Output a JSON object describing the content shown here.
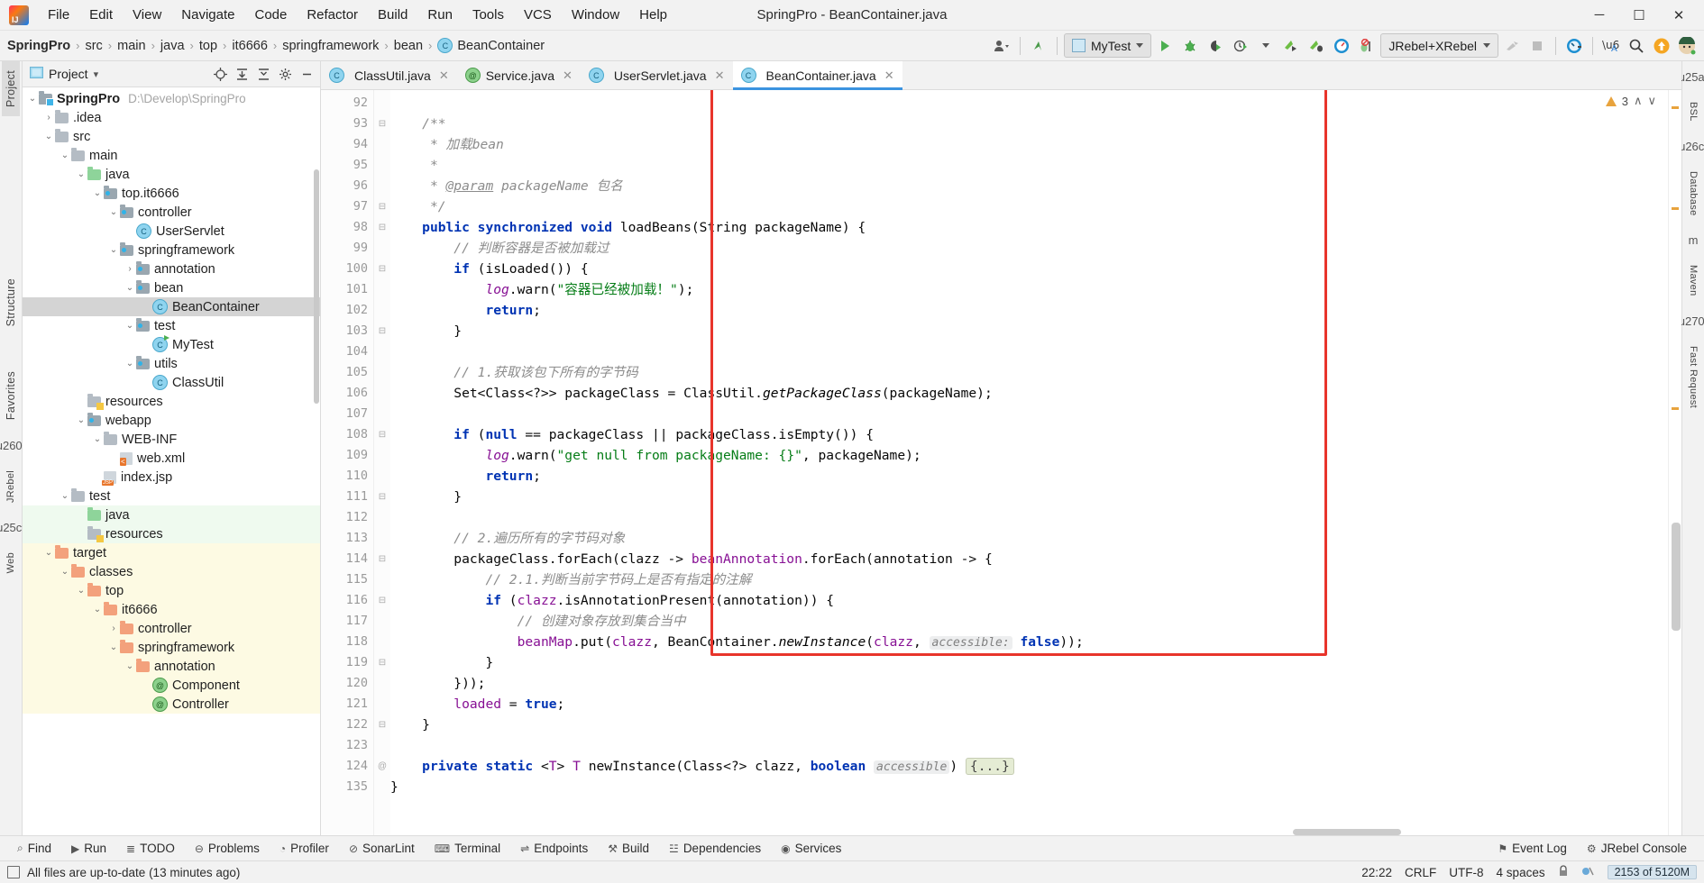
{
  "window": {
    "title": "SpringPro - BeanContainer.java",
    "minimize": "─",
    "maximize": "☐",
    "close": "✕"
  },
  "menubar": {
    "logo": "intellij-idea-logo",
    "items": [
      "File",
      "Edit",
      "View",
      "Navigate",
      "Code",
      "Refactor",
      "Build",
      "Run",
      "Tools",
      "VCS",
      "Window",
      "Help"
    ]
  },
  "breadcrumb": {
    "sep": "›",
    "items": [
      {
        "label": "SpringPro",
        "bold": true
      },
      {
        "label": "src",
        "bold": false
      },
      {
        "label": "main",
        "bold": false
      },
      {
        "label": "java",
        "bold": false
      },
      {
        "label": "top",
        "bold": false
      },
      {
        "label": "it6666",
        "bold": false
      },
      {
        "label": "springframework",
        "bold": false
      },
      {
        "label": "bean",
        "bold": false
      },
      {
        "label": "BeanContainer",
        "bold": false,
        "icon": "class-icon",
        "icon_char": "C"
      }
    ]
  },
  "toolbar": {
    "vcs_user_icon": "user-dropdown-icon",
    "update_icon": "update-project-icon",
    "run_config": {
      "label": "MyTest",
      "icon": "run-configuration-icon",
      "caret": "⌄"
    },
    "run_icon": "run-icon",
    "debug_icon": "debug-icon",
    "run_coverage_icon": "run-with-coverage-icon",
    "profiler_icon": "profiler-icon",
    "jrebel_run_icon": "jrebel-run-icon",
    "jrebel_debug_icon": "jrebel-debug-icon",
    "xrebel_icon": "xrebel-icon",
    "stop_jrebel_icon": "jrebel-stop-icon",
    "jrebel_combo": {
      "label": "JRebel+XRebel",
      "caret": "⌄"
    },
    "hammer_icon": "build-icon",
    "stop_icon": "stop-icon",
    "gauge_icon": "jrebel-gauge-icon",
    "translate_icon": "translate-icon",
    "search_icon": "search-everywhere-icon",
    "upload_icon": "upload-icon",
    "avatar_icon": "user-avatar-icon"
  },
  "left_rail": {
    "tabs": [
      "Project",
      "Structure",
      "Favorites"
    ],
    "icons": [
      "jrebel-rail-icon",
      "web-rail-icon"
    ]
  },
  "right_rail": {
    "tabs": [
      "BSL",
      "Database",
      "Maven",
      "Fast Request"
    ]
  },
  "project_panel": {
    "title": "Project",
    "title_caret": "▾",
    "icons": [
      "locate-icon",
      "expand-all-icon",
      "collapse-all-icon",
      "settings-icon",
      "hide-icon"
    ],
    "tree": [
      {
        "depth": 0,
        "arrow": "down",
        "icon": "module-folder",
        "label": "SpringPro",
        "bold": true,
        "path": "D:\\Develop\\SpringPro",
        "hl": ""
      },
      {
        "depth": 1,
        "arrow": "right",
        "icon": "folder",
        "label": ".idea",
        "hl": ""
      },
      {
        "depth": 1,
        "arrow": "down",
        "icon": "folder",
        "label": "src",
        "hl": ""
      },
      {
        "depth": 2,
        "arrow": "down",
        "icon": "folder",
        "label": "main",
        "hl": ""
      },
      {
        "depth": 3,
        "arrow": "down",
        "icon": "source-folder",
        "label": "java",
        "hl": ""
      },
      {
        "depth": 4,
        "arrow": "down",
        "icon": "package",
        "label": "top.it6666",
        "hl": ""
      },
      {
        "depth": 5,
        "arrow": "down",
        "icon": "package",
        "label": "controller",
        "hl": ""
      },
      {
        "depth": 6,
        "arrow": "none",
        "icon": "class",
        "label": "UserServlet",
        "hl": ""
      },
      {
        "depth": 5,
        "arrow": "down",
        "icon": "package",
        "label": "springframework",
        "hl": ""
      },
      {
        "depth": 6,
        "arrow": "right",
        "icon": "package",
        "label": "annotation",
        "hl": ""
      },
      {
        "depth": 6,
        "arrow": "down",
        "icon": "package",
        "label": "bean",
        "hl": ""
      },
      {
        "depth": 7,
        "arrow": "none",
        "icon": "class",
        "label": "BeanContainer",
        "hl": "selected"
      },
      {
        "depth": 6,
        "arrow": "down",
        "icon": "package",
        "label": "test",
        "hl": ""
      },
      {
        "depth": 7,
        "arrow": "none",
        "icon": "class-runnable",
        "label": "MyTest",
        "hl": ""
      },
      {
        "depth": 6,
        "arrow": "down",
        "icon": "package",
        "label": "utils",
        "hl": ""
      },
      {
        "depth": 7,
        "arrow": "none",
        "icon": "class",
        "label": "ClassUtil",
        "hl": ""
      },
      {
        "depth": 3,
        "arrow": "none",
        "icon": "resources-folder",
        "label": "resources",
        "hl": ""
      },
      {
        "depth": 3,
        "arrow": "down",
        "icon": "webapp-folder",
        "label": "webapp",
        "hl": ""
      },
      {
        "depth": 4,
        "arrow": "down",
        "icon": "folder",
        "label": "WEB-INF",
        "hl": ""
      },
      {
        "depth": 5,
        "arrow": "none",
        "icon": "xml-file",
        "label": "web.xml",
        "hl": ""
      },
      {
        "depth": 4,
        "arrow": "none",
        "icon": "jsp-file",
        "label": "index.jsp",
        "hl": ""
      },
      {
        "depth": 2,
        "arrow": "down",
        "icon": "folder",
        "label": "test",
        "hl": ""
      },
      {
        "depth": 3,
        "arrow": "none",
        "icon": "test-source-folder",
        "label": "java",
        "hl": "green"
      },
      {
        "depth": 3,
        "arrow": "none",
        "icon": "test-resources-folder",
        "label": "resources",
        "hl": "green"
      },
      {
        "depth": 1,
        "arrow": "down",
        "icon": "excluded-folder",
        "label": "target",
        "hl": "yellow"
      },
      {
        "depth": 2,
        "arrow": "down",
        "icon": "excluded-folder",
        "label": "classes",
        "hl": "yellow"
      },
      {
        "depth": 3,
        "arrow": "down",
        "icon": "excluded-folder",
        "label": "top",
        "hl": "yellow"
      },
      {
        "depth": 4,
        "arrow": "down",
        "icon": "excluded-folder",
        "label": "it6666",
        "hl": "yellow"
      },
      {
        "depth": 5,
        "arrow": "right",
        "icon": "excluded-folder",
        "label": "controller",
        "hl": "yellow"
      },
      {
        "depth": 5,
        "arrow": "down",
        "icon": "excluded-folder",
        "label": "springframework",
        "hl": "yellow"
      },
      {
        "depth": 6,
        "arrow": "down",
        "icon": "excluded-folder",
        "label": "annotation",
        "hl": "yellow"
      },
      {
        "depth": 7,
        "arrow": "none",
        "icon": "annotation-class",
        "label": "Component",
        "hl": "yellow"
      },
      {
        "depth": 7,
        "arrow": "none",
        "icon": "annotation-class",
        "label": "Controller",
        "hl": "yellow"
      }
    ]
  },
  "editor": {
    "tabs": [
      {
        "label": "ClassUtil.java",
        "icon": "class-icon",
        "icon_char": "C",
        "active": false,
        "close": "✕"
      },
      {
        "label": "Service.java",
        "icon": "annotation-icon",
        "icon_char": "@",
        "active": false,
        "close": "✕"
      },
      {
        "label": "UserServlet.java",
        "icon": "class-icon",
        "icon_char": "C",
        "active": false,
        "close": "✕"
      },
      {
        "label": "BeanContainer.java",
        "icon": "class-icon",
        "icon_char": "C",
        "active": true,
        "close": "✕"
      }
    ],
    "inspection": {
      "count": "3",
      "up": "∧",
      "down": "∨",
      "icon": "warning-triangle-icon"
    },
    "first_line": 92,
    "lines": [
      {
        "n": 92,
        "fold": "",
        "html": ""
      },
      {
        "n": 93,
        "fold": "minus",
        "html": "    <span class='doc'>/**</span>"
      },
      {
        "n": 94,
        "fold": "",
        "html": "     <span class='doc'>* 加载bean</span>"
      },
      {
        "n": 95,
        "fold": "",
        "html": "     <span class='doc'>*</span>"
      },
      {
        "n": 96,
        "fold": "",
        "html": "     <span class='doc'>* </span><span class='docp'>@param</span><span class='doc'> packageName 包名</span>"
      },
      {
        "n": 97,
        "fold": "minus",
        "html": "     <span class='doc'>*/</span>"
      },
      {
        "n": 98,
        "fold": "minus",
        "html": "    <span class='k'>public synchronized void</span> loadBeans(String packageName) {"
      },
      {
        "n": 99,
        "fold": "",
        "html": "        <span class='c'>// 判断容器是否被加载过</span>"
      },
      {
        "n": 100,
        "fold": "minus",
        "html": "        <span class='k'>if</span> (isLoaded()) {"
      },
      {
        "n": 101,
        "fold": "",
        "html": "            <span class='f'><i>log</i></span>.warn(<span class='s'>\"容器已经被加载！\"</span>);"
      },
      {
        "n": 102,
        "fold": "",
        "html": "            <span class='k'>return</span>;"
      },
      {
        "n": 103,
        "fold": "minus",
        "html": "        }"
      },
      {
        "n": 104,
        "fold": "",
        "html": ""
      },
      {
        "n": 105,
        "fold": "",
        "html": "        <span class='c'>// 1.获取该包下所有的字节码</span>"
      },
      {
        "n": 106,
        "fold": "",
        "html": "        Set&lt;Class&lt;?&gt;&gt; packageClass = ClassUtil.<span class='m'>getPackageClass</span>(packageName);"
      },
      {
        "n": 107,
        "fold": "",
        "html": ""
      },
      {
        "n": 108,
        "fold": "minus",
        "html": "        <span class='k'>if</span> (<span class='k'>null</span> == packageClass || packageClass.isEmpty()) {"
      },
      {
        "n": 109,
        "fold": "",
        "html": "            <span class='f'><i>log</i></span>.warn(<span class='s'>\"get null from packageName: {}\"</span>, packageName);"
      },
      {
        "n": 110,
        "fold": "",
        "html": "            <span class='k'>return</span>;"
      },
      {
        "n": 111,
        "fold": "minus",
        "html": "        }"
      },
      {
        "n": 112,
        "fold": "",
        "html": ""
      },
      {
        "n": 113,
        "fold": "",
        "html": "        <span class='c'>// 2.遍历所有的字节码对象</span>"
      },
      {
        "n": 114,
        "fold": "minus",
        "html": "        packageClass.forEach(clazz -&gt; <span class='f'>beanAnnotation</span>.forEach(annotation -&gt; {"
      },
      {
        "n": 115,
        "fold": "",
        "html": "            <span class='c'>// 2.1.判断当前字节码上是否有指定的注解</span>"
      },
      {
        "n": 116,
        "fold": "minus",
        "html": "            <span class='k'>if</span> (<span class='f'>clazz</span>.isAnnotationPresent(annotation)) {"
      },
      {
        "n": 117,
        "fold": "",
        "html": "                <span class='c'>// 创建对象存放到集合当中</span>"
      },
      {
        "n": 118,
        "fold": "",
        "html": "                <span class='f'>beanMap</span>.put(<span class='f'>clazz</span>, BeanContainer.<span class='m'>newInstance</span>(<span class='f'>clazz</span>, <span class='hint'>accessible:</span> <span class='k'>false</span>));"
      },
      {
        "n": 119,
        "fold": "minus",
        "html": "            }"
      },
      {
        "n": 120,
        "fold": "",
        "html": "        }));"
      },
      {
        "n": 121,
        "fold": "",
        "html": "        <span class='f'>loaded</span> = <span class='k'>true</span>;"
      },
      {
        "n": 122,
        "fold": "minus",
        "html": "    }"
      },
      {
        "n": 123,
        "fold": "",
        "html": ""
      },
      {
        "n": 124,
        "fold": "at",
        "html": "    <span class='k'>private static</span> &lt;<span class='f'>T</span>&gt; <span class='f'>T</span> newInstance(Class&lt;?&gt; clazz, <span class='k'>boolean</span> <span class='hint'>accessible</span>) <span class='folded'>{...}</span>"
      },
      {
        "n": 135,
        "fold": "",
        "html": "}"
      }
    ]
  },
  "bottom_tools": [
    {
      "label": "Find",
      "icon": "find-icon"
    },
    {
      "label": "Run",
      "icon": "run-icon"
    },
    {
      "label": "TODO",
      "icon": "todo-icon"
    },
    {
      "label": "Problems",
      "icon": "problems-icon"
    },
    {
      "label": "Profiler",
      "icon": "profiler-icon"
    },
    {
      "label": "SonarLint",
      "icon": "sonarlint-icon"
    },
    {
      "label": "Terminal",
      "icon": "terminal-icon"
    },
    {
      "label": "Endpoints",
      "icon": "endpoints-icon"
    },
    {
      "label": "Build",
      "icon": "build-icon"
    },
    {
      "label": "Dependencies",
      "icon": "dependencies-icon"
    },
    {
      "label": "Services",
      "icon": "services-icon"
    }
  ],
  "bottom_tools_right": [
    {
      "label": "Event Log",
      "icon": "event-log-icon"
    },
    {
      "label": "JRebel Console",
      "icon": "jrebel-console-icon"
    }
  ],
  "statusbar": {
    "message": "All files are up-to-date (13 minutes ago)",
    "message_icon": "file-status-icon",
    "caret": "22:22",
    "line_separator": "CRLF",
    "encoding": "UTF-8",
    "indent": "4 spaces",
    "lock_icon": "read-only-lock-icon",
    "inspection_icon": "inspection-level-icon",
    "memory": "2153 of 5120M"
  },
  "colors": {
    "accent": "#3b93e0",
    "keyword": "#0033b3",
    "string": "#067d17",
    "comment": "#8c8c8c",
    "field": "#871094",
    "redbox": "#e8342b",
    "selection": "#d4d4d4",
    "excluded": "#fdfae3",
    "test_source": "#effaef"
  }
}
